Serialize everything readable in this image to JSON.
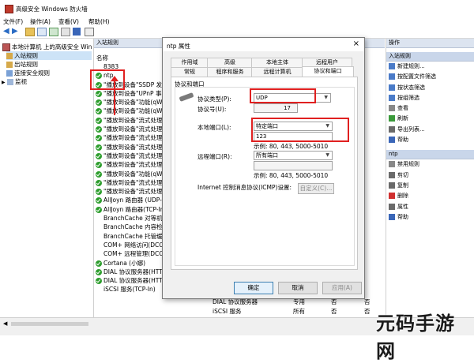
{
  "window": {
    "title": "高级安全 Windows 防火墙"
  },
  "menubar": [
    "文件(F)",
    "操作(A)",
    "查看(V)",
    "帮助(H)"
  ],
  "nav": {
    "root": "本地计算机 上的高级安全 Win",
    "items": [
      "入站规则",
      "出站规则",
      "连接安全规则",
      "监视"
    ]
  },
  "center": {
    "header": "入站规则",
    "column": "名称",
    "rows": [
      {
        "name": "8383",
        "icon": "none"
      },
      {
        "name": "ntp",
        "icon": "green"
      },
      {
        "name": "\"播放到设备\"SSDP 发",
        "icon": "green"
      },
      {
        "name": "\"播放到设备\"UPnP 事",
        "icon": "green"
      },
      {
        "name": "\"播放到设备\"功能(qWa",
        "icon": "green"
      },
      {
        "name": "\"播放到设备\"功能(qWa",
        "icon": "green"
      },
      {
        "name": "\"播放到设备\"流式处理",
        "icon": "green"
      },
      {
        "name": "\"播放到设备\"流式处理",
        "icon": "green"
      },
      {
        "name": "\"播放到设备\"流式处理",
        "icon": "green"
      },
      {
        "name": "\"播放到设备\"流式处理",
        "icon": "green"
      },
      {
        "name": "\"播放到设备\"流式处理",
        "icon": "green"
      },
      {
        "name": "\"播放到设备\"流式处理",
        "icon": "green"
      },
      {
        "name": "\"播放到设备\"功能(qWa",
        "icon": "green"
      },
      {
        "name": "\"播放到设备\"流式处理",
        "icon": "green"
      },
      {
        "name": "\"播放到设备\"流式处理",
        "icon": "green"
      },
      {
        "name": "AllJoyn 路由器 (UDP-I",
        "icon": "green"
      },
      {
        "name": "AllJoyn 路由器(TCP-In",
        "icon": "green"
      },
      {
        "name": "BranchCache 对等机发",
        "icon": "none"
      },
      {
        "name": "BranchCache 内容检索",
        "icon": "none"
      },
      {
        "name": "BranchCache 托管缓存",
        "icon": "none"
      },
      {
        "name": "COM+ 网络访问(DCOM",
        "icon": "none"
      },
      {
        "name": "COM+ 远程管理(DCOM",
        "icon": "none"
      },
      {
        "name": "Cortana (小娜)",
        "icon": "green"
      },
      {
        "name": "DIAL 协议服务器(HTTP-",
        "icon": "green"
      },
      {
        "name": "DIAL 协议服务器(HTTP-In)",
        "icon": "green"
      },
      {
        "name": "iSCSI 服务(TCP-In)",
        "icon": "none"
      }
    ],
    "bottom_cols": [
      {
        "group": "DIAL 协议服务器",
        "profile": "专用",
        "enabled": "否"
      },
      {
        "group": "iSCSI 服务",
        "profile": "所有",
        "enabled": "否"
      }
    ],
    "extra_cols": [
      "否",
      "否"
    ]
  },
  "actions": {
    "header": "操作",
    "section1": "入站规则",
    "items1": [
      "新建规则...",
      "按配置文件筛选",
      "按状态筛选",
      "按组筛选",
      "查看",
      "刷新",
      "导出列表...",
      "帮助"
    ],
    "section2": "ntp",
    "items2": [
      "禁用规则",
      "剪切",
      "复制",
      "删除",
      "属性",
      "帮助"
    ]
  },
  "dialog": {
    "title": "ntp 属性",
    "close": "×",
    "tabs_row1": [
      "作用域",
      "高级",
      "本地主体",
      "远程用户"
    ],
    "tabs_row2": [
      "常规",
      "程序和服务",
      "远程计算机",
      "协议和端口"
    ],
    "group": "协议和端口",
    "protocol_type_label": "协议类型(P):",
    "protocol_type_value": "UDP",
    "protocol_number_label": "协议号(U):",
    "protocol_number_value": "17",
    "local_port_label": "本地端口(L):",
    "local_port_value": "特定端口",
    "local_port_entry": "123",
    "local_example": "示例: 80, 443, 5000-5010",
    "remote_port_label": "远程端口(R):",
    "remote_port_value": "所有端口",
    "remote_example": "示例: 80, 443, 5000-5010",
    "icmp_label": "Internet 控制消息协议(ICMP)设置:",
    "custom_button": "自定义(C)...",
    "ok": "确定",
    "cancel": "取消",
    "apply": "应用(A)"
  },
  "watermark": "元码手游网",
  "colors": {
    "accent_red": "#e02020",
    "header_bg": "#dce4f0",
    "rule_green": "#2e9e2e"
  }
}
